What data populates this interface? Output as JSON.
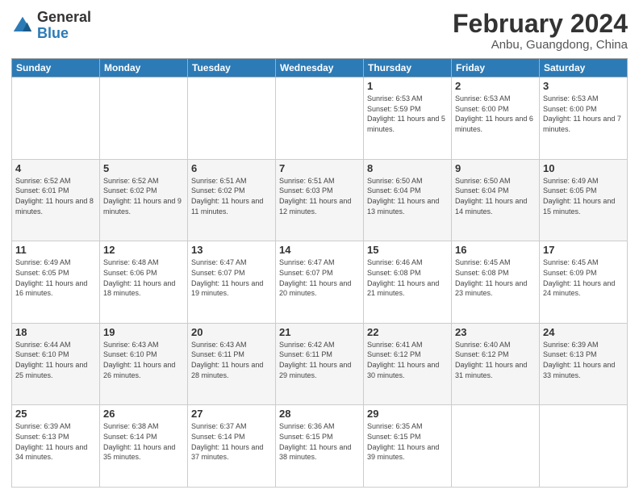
{
  "logo": {
    "general": "General",
    "blue": "Blue"
  },
  "title": {
    "month_year": "February 2024",
    "location": "Anbu, Guangdong, China"
  },
  "headers": [
    "Sunday",
    "Monday",
    "Tuesday",
    "Wednesday",
    "Thursday",
    "Friday",
    "Saturday"
  ],
  "weeks": [
    [
      {
        "day": "",
        "info": ""
      },
      {
        "day": "",
        "info": ""
      },
      {
        "day": "",
        "info": ""
      },
      {
        "day": "",
        "info": ""
      },
      {
        "day": "1",
        "info": "Sunrise: 6:53 AM\nSunset: 5:59 PM\nDaylight: 11 hours and 5 minutes."
      },
      {
        "day": "2",
        "info": "Sunrise: 6:53 AM\nSunset: 6:00 PM\nDaylight: 11 hours and 6 minutes."
      },
      {
        "day": "3",
        "info": "Sunrise: 6:53 AM\nSunset: 6:00 PM\nDaylight: 11 hours and 7 minutes."
      }
    ],
    [
      {
        "day": "4",
        "info": "Sunrise: 6:52 AM\nSunset: 6:01 PM\nDaylight: 11 hours and 8 minutes."
      },
      {
        "day": "5",
        "info": "Sunrise: 6:52 AM\nSunset: 6:02 PM\nDaylight: 11 hours and 9 minutes."
      },
      {
        "day": "6",
        "info": "Sunrise: 6:51 AM\nSunset: 6:02 PM\nDaylight: 11 hours and 11 minutes."
      },
      {
        "day": "7",
        "info": "Sunrise: 6:51 AM\nSunset: 6:03 PM\nDaylight: 11 hours and 12 minutes."
      },
      {
        "day": "8",
        "info": "Sunrise: 6:50 AM\nSunset: 6:04 PM\nDaylight: 11 hours and 13 minutes."
      },
      {
        "day": "9",
        "info": "Sunrise: 6:50 AM\nSunset: 6:04 PM\nDaylight: 11 hours and 14 minutes."
      },
      {
        "day": "10",
        "info": "Sunrise: 6:49 AM\nSunset: 6:05 PM\nDaylight: 11 hours and 15 minutes."
      }
    ],
    [
      {
        "day": "11",
        "info": "Sunrise: 6:49 AM\nSunset: 6:05 PM\nDaylight: 11 hours and 16 minutes."
      },
      {
        "day": "12",
        "info": "Sunrise: 6:48 AM\nSunset: 6:06 PM\nDaylight: 11 hours and 18 minutes."
      },
      {
        "day": "13",
        "info": "Sunrise: 6:47 AM\nSunset: 6:07 PM\nDaylight: 11 hours and 19 minutes."
      },
      {
        "day": "14",
        "info": "Sunrise: 6:47 AM\nSunset: 6:07 PM\nDaylight: 11 hours and 20 minutes."
      },
      {
        "day": "15",
        "info": "Sunrise: 6:46 AM\nSunset: 6:08 PM\nDaylight: 11 hours and 21 minutes."
      },
      {
        "day": "16",
        "info": "Sunrise: 6:45 AM\nSunset: 6:08 PM\nDaylight: 11 hours and 23 minutes."
      },
      {
        "day": "17",
        "info": "Sunrise: 6:45 AM\nSunset: 6:09 PM\nDaylight: 11 hours and 24 minutes."
      }
    ],
    [
      {
        "day": "18",
        "info": "Sunrise: 6:44 AM\nSunset: 6:10 PM\nDaylight: 11 hours and 25 minutes."
      },
      {
        "day": "19",
        "info": "Sunrise: 6:43 AM\nSunset: 6:10 PM\nDaylight: 11 hours and 26 minutes."
      },
      {
        "day": "20",
        "info": "Sunrise: 6:43 AM\nSunset: 6:11 PM\nDaylight: 11 hours and 28 minutes."
      },
      {
        "day": "21",
        "info": "Sunrise: 6:42 AM\nSunset: 6:11 PM\nDaylight: 11 hours and 29 minutes."
      },
      {
        "day": "22",
        "info": "Sunrise: 6:41 AM\nSunset: 6:12 PM\nDaylight: 11 hours and 30 minutes."
      },
      {
        "day": "23",
        "info": "Sunrise: 6:40 AM\nSunset: 6:12 PM\nDaylight: 11 hours and 31 minutes."
      },
      {
        "day": "24",
        "info": "Sunrise: 6:39 AM\nSunset: 6:13 PM\nDaylight: 11 hours and 33 minutes."
      }
    ],
    [
      {
        "day": "25",
        "info": "Sunrise: 6:39 AM\nSunset: 6:13 PM\nDaylight: 11 hours and 34 minutes."
      },
      {
        "day": "26",
        "info": "Sunrise: 6:38 AM\nSunset: 6:14 PM\nDaylight: 11 hours and 35 minutes."
      },
      {
        "day": "27",
        "info": "Sunrise: 6:37 AM\nSunset: 6:14 PM\nDaylight: 11 hours and 37 minutes."
      },
      {
        "day": "28",
        "info": "Sunrise: 6:36 AM\nSunset: 6:15 PM\nDaylight: 11 hours and 38 minutes."
      },
      {
        "day": "29",
        "info": "Sunrise: 6:35 AM\nSunset: 6:15 PM\nDaylight: 11 hours and 39 minutes."
      },
      {
        "day": "",
        "info": ""
      },
      {
        "day": "",
        "info": ""
      }
    ]
  ]
}
